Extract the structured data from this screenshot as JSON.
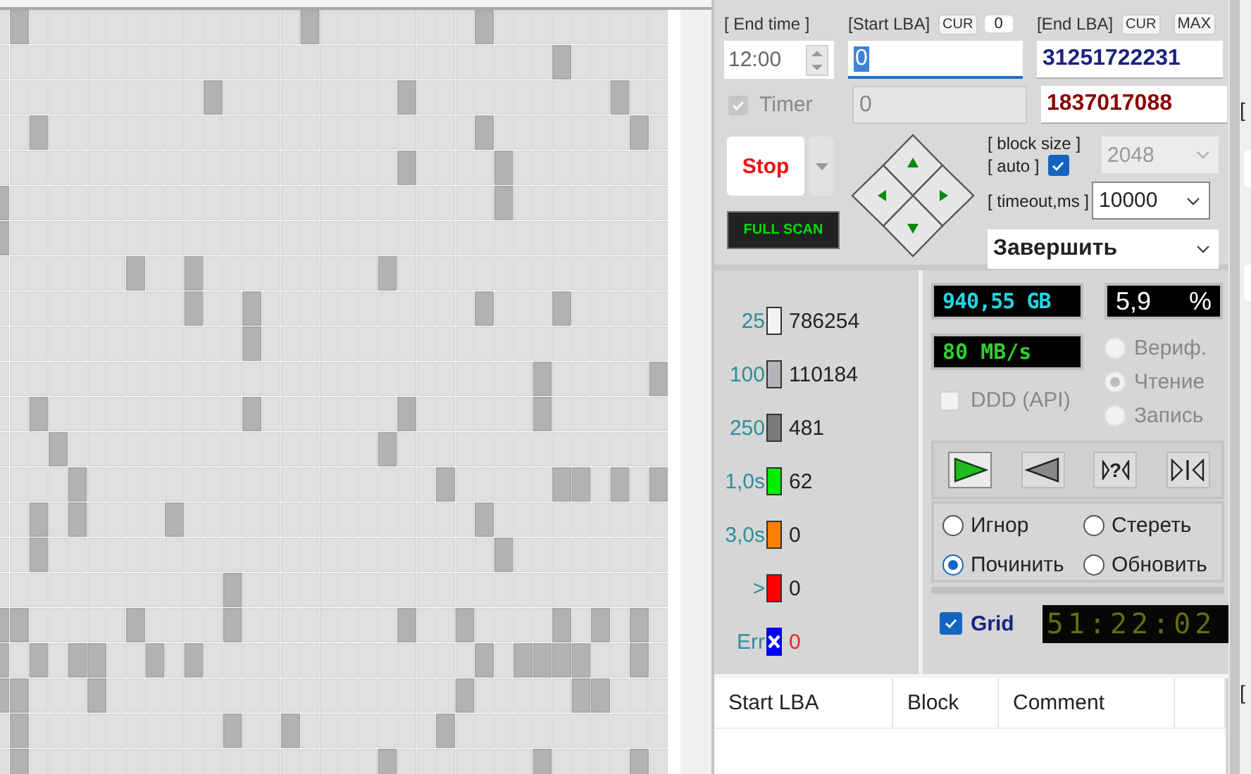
{
  "scan_map": {
    "rows": [
      [
        false,
        true,
        false,
        false,
        false,
        false,
        false,
        false,
        false,
        false,
        false,
        false,
        false,
        false,
        false,
        false,
        true,
        false,
        false,
        false,
        false,
        false,
        false,
        false,
        false,
        true,
        false,
        false,
        false,
        false,
        false,
        false,
        false,
        false,
        false
      ],
      [
        false,
        false,
        false,
        false,
        false,
        false,
        false,
        false,
        false,
        false,
        false,
        false,
        false,
        false,
        false,
        false,
        false,
        false,
        false,
        false,
        false,
        false,
        false,
        false,
        false,
        false,
        false,
        false,
        false,
        true,
        false,
        false,
        false,
        false,
        false
      ],
      [
        false,
        false,
        false,
        false,
        false,
        false,
        false,
        false,
        false,
        false,
        false,
        true,
        false,
        false,
        false,
        false,
        false,
        false,
        false,
        false,
        false,
        true,
        false,
        false,
        false,
        false,
        false,
        false,
        false,
        false,
        false,
        false,
        true,
        false,
        false
      ],
      [
        false,
        false,
        true,
        false,
        false,
        false,
        false,
        false,
        false,
        false,
        false,
        false,
        false,
        false,
        false,
        false,
        false,
        false,
        false,
        false,
        false,
        false,
        false,
        false,
        false,
        true,
        false,
        false,
        false,
        false,
        false,
        false,
        false,
        true,
        false
      ],
      [
        false,
        false,
        false,
        false,
        false,
        false,
        false,
        false,
        false,
        false,
        false,
        false,
        false,
        false,
        false,
        false,
        false,
        false,
        false,
        false,
        false,
        true,
        false,
        false,
        false,
        false,
        true,
        false,
        false,
        false,
        false,
        false,
        false,
        false,
        false
      ],
      [
        true,
        false,
        false,
        false,
        false,
        false,
        false,
        false,
        false,
        false,
        false,
        false,
        false,
        false,
        false,
        false,
        false,
        false,
        false,
        false,
        false,
        false,
        false,
        false,
        false,
        false,
        true,
        false,
        false,
        false,
        false,
        false,
        false,
        false,
        false
      ],
      [
        true,
        false,
        false,
        false,
        false,
        false,
        false,
        false,
        false,
        false,
        false,
        false,
        false,
        false,
        false,
        false,
        false,
        false,
        false,
        false,
        false,
        false,
        false,
        false,
        false,
        false,
        false,
        false,
        false,
        false,
        false,
        false,
        false,
        false,
        false
      ],
      [
        false,
        false,
        false,
        false,
        false,
        false,
        false,
        true,
        false,
        false,
        true,
        false,
        false,
        false,
        false,
        false,
        false,
        false,
        false,
        false,
        true,
        false,
        false,
        false,
        false,
        false,
        false,
        false,
        false,
        false,
        false,
        false,
        false,
        false,
        false
      ],
      [
        false,
        false,
        false,
        false,
        false,
        false,
        false,
        false,
        false,
        false,
        true,
        false,
        false,
        true,
        false,
        false,
        false,
        false,
        false,
        false,
        false,
        false,
        false,
        false,
        false,
        true,
        false,
        false,
        false,
        true,
        false,
        false,
        false,
        false,
        false
      ],
      [
        false,
        false,
        false,
        false,
        false,
        false,
        false,
        false,
        false,
        false,
        false,
        false,
        false,
        true,
        false,
        false,
        false,
        false,
        false,
        false,
        false,
        false,
        false,
        false,
        false,
        false,
        false,
        false,
        false,
        false,
        false,
        false,
        false,
        false,
        false
      ],
      [
        false,
        false,
        false,
        false,
        false,
        false,
        false,
        false,
        false,
        false,
        false,
        false,
        false,
        false,
        false,
        false,
        false,
        false,
        false,
        false,
        false,
        false,
        false,
        false,
        false,
        false,
        false,
        false,
        true,
        false,
        false,
        false,
        false,
        false,
        true
      ],
      [
        false,
        false,
        true,
        false,
        false,
        false,
        false,
        false,
        false,
        false,
        false,
        false,
        false,
        true,
        false,
        false,
        false,
        false,
        false,
        false,
        false,
        true,
        false,
        false,
        false,
        false,
        false,
        false,
        true,
        false,
        false,
        false,
        false,
        false,
        false
      ],
      [
        false,
        false,
        false,
        true,
        false,
        false,
        false,
        false,
        false,
        false,
        false,
        false,
        false,
        false,
        false,
        false,
        false,
        false,
        false,
        false,
        true,
        false,
        false,
        false,
        false,
        false,
        false,
        false,
        false,
        false,
        false,
        false,
        false,
        false,
        false
      ],
      [
        false,
        false,
        false,
        false,
        true,
        false,
        false,
        false,
        false,
        false,
        false,
        false,
        false,
        false,
        false,
        false,
        false,
        false,
        false,
        false,
        false,
        false,
        false,
        true,
        false,
        false,
        false,
        false,
        false,
        true,
        true,
        false,
        true,
        false,
        true
      ],
      [
        false,
        false,
        true,
        false,
        true,
        false,
        false,
        false,
        false,
        true,
        false,
        false,
        false,
        false,
        false,
        false,
        false,
        false,
        false,
        false,
        false,
        false,
        false,
        false,
        false,
        true,
        false,
        false,
        false,
        false,
        false,
        false,
        false,
        false,
        false
      ],
      [
        false,
        false,
        true,
        false,
        false,
        false,
        false,
        false,
        false,
        false,
        false,
        false,
        false,
        false,
        false,
        false,
        false,
        false,
        false,
        false,
        false,
        false,
        false,
        false,
        false,
        false,
        true,
        false,
        false,
        false,
        false,
        false,
        false,
        false,
        false
      ],
      [
        false,
        false,
        false,
        false,
        false,
        false,
        false,
        false,
        false,
        false,
        false,
        false,
        true,
        false,
        false,
        false,
        false,
        false,
        false,
        false,
        false,
        false,
        false,
        false,
        false,
        false,
        false,
        false,
        false,
        false,
        false,
        false,
        false,
        false,
        false
      ],
      [
        true,
        true,
        false,
        false,
        false,
        false,
        false,
        true,
        false,
        false,
        false,
        false,
        true,
        false,
        false,
        false,
        false,
        false,
        false,
        false,
        false,
        true,
        false,
        false,
        true,
        false,
        false,
        false,
        false,
        true,
        false,
        true,
        false,
        true,
        false
      ],
      [
        true,
        false,
        true,
        false,
        true,
        true,
        false,
        false,
        true,
        false,
        true,
        false,
        false,
        false,
        false,
        false,
        false,
        false,
        false,
        false,
        false,
        false,
        false,
        false,
        false,
        true,
        false,
        true,
        true,
        true,
        true,
        false,
        false,
        true,
        false
      ],
      [
        true,
        true,
        false,
        false,
        false,
        true,
        false,
        false,
        false,
        false,
        false,
        false,
        false,
        false,
        false,
        false,
        false,
        false,
        false,
        false,
        false,
        false,
        false,
        false,
        true,
        false,
        false,
        false,
        false,
        false,
        true,
        true,
        false,
        false,
        false
      ],
      [
        false,
        true,
        false,
        false,
        false,
        false,
        false,
        false,
        false,
        false,
        false,
        false,
        true,
        false,
        false,
        true,
        false,
        false,
        false,
        false,
        false,
        false,
        false,
        true,
        false,
        false,
        false,
        false,
        false,
        false,
        false,
        false,
        false,
        false,
        false
      ],
      [
        false,
        true,
        false,
        false,
        false,
        false,
        false,
        false,
        false,
        false,
        false,
        false,
        false,
        false,
        false,
        false,
        false,
        false,
        false,
        false,
        true,
        false,
        false,
        false,
        false,
        false,
        false,
        false,
        true,
        false,
        false,
        false,
        false,
        true,
        false
      ]
    ]
  },
  "controls": {
    "end_time_label": "[ End time ]",
    "start_lba_label": "[Start LBA]",
    "start_cur_button": "CUR",
    "start_cur_value": "0",
    "end_lba_label": "[End LBA]",
    "end_cur_button": "CUR",
    "max_button": "MAX",
    "end_time": "12:00",
    "start_lba": "0",
    "end_lba": "31251722231",
    "timer": {
      "label": "Timer",
      "checked": true,
      "disabled": true
    },
    "current_lba": "0",
    "end_lba_secondary": "1837017088",
    "stop_button": "Stop",
    "full_scan_button": "FULL SCAN",
    "block_size_label": "[ block size ]",
    "auto_label": "[ auto ]",
    "auto_checked": true,
    "block_size": "2048",
    "block_size_disabled": true,
    "timeout_label": "[ timeout,ms ]",
    "timeout": "10000",
    "finish_action": "Завершить"
  },
  "legend": [
    {
      "label": "25",
      "color": "#f4f4f4",
      "count": "786254",
      "kind": "box"
    },
    {
      "label": "100",
      "color": "#b4b4b8",
      "count": "110184",
      "kind": "box"
    },
    {
      "label": "250",
      "color": "#7a7a7a",
      "count": "481",
      "kind": "box"
    },
    {
      "label": "1,0s",
      "color": "#00ee00",
      "count": "62",
      "kind": "box"
    },
    {
      "label": "3,0s",
      "color": "#ff8000",
      "count": "0",
      "kind": "box"
    },
    {
      "label": ">",
      "color": "#ff0000",
      "count": "0",
      "kind": "box"
    },
    {
      "label": "Err",
      "color": "#0000ff",
      "count": "0",
      "kind": "error"
    }
  ],
  "readouts": {
    "size": "940,55 GB",
    "percent": "5,9",
    "percent_unit": "%",
    "speed": "80 MB/s"
  },
  "ddd": {
    "label": "DDD (API)",
    "checked": false,
    "disabled": true
  },
  "modes": [
    {
      "label": "Вериф.",
      "selected": false,
      "disabled": true
    },
    {
      "label": "Чтение",
      "selected": true,
      "disabled": true
    },
    {
      "label": "Запись",
      "selected": false,
      "disabled": true
    }
  ],
  "transport": [
    {
      "kind": "play",
      "selected": true
    },
    {
      "kind": "back",
      "selected": false
    },
    {
      "kind": "query",
      "label": "?",
      "selected": false
    },
    {
      "kind": "jump",
      "selected": false
    }
  ],
  "actions": [
    {
      "label": "Игнор",
      "selected": false
    },
    {
      "label": "Стереть",
      "selected": false
    },
    {
      "label": "Починить",
      "selected": true
    },
    {
      "label": "Обновить",
      "selected": false
    }
  ],
  "grid_toggle": {
    "label": "Grid",
    "checked": true
  },
  "timer_display": "51:22:02",
  "table": {
    "columns": [
      "Start LBA",
      "Block",
      "Comment"
    ]
  },
  "right_edge": [
    "[",
    "["
  ]
}
